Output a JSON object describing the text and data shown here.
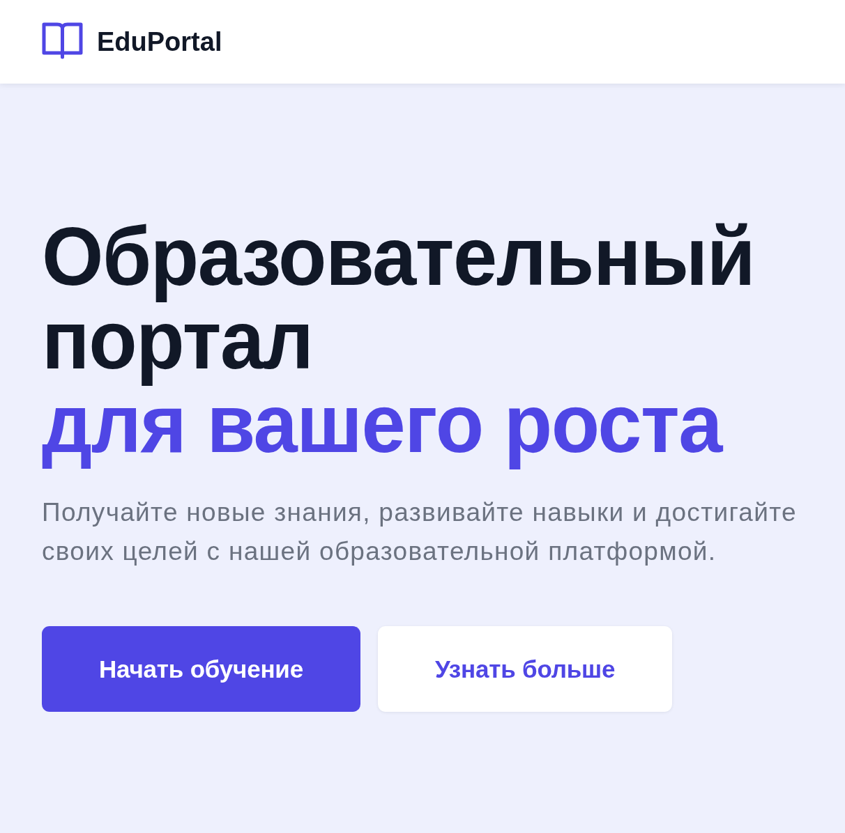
{
  "header": {
    "logo_text": "EduPortal"
  },
  "hero": {
    "heading": {
      "text": "Образовательный портал",
      "highlight": "для вашего роста"
    },
    "subtitle": "Получайте новые знания, развивайте навыки и достигайте своих целей с нашей образовательной платформой.",
    "buttons": [
      {
        "label": "Начать обучение",
        "kind": "primary"
      },
      {
        "label": "Узнать больше",
        "kind": "secondary"
      }
    ]
  }
}
